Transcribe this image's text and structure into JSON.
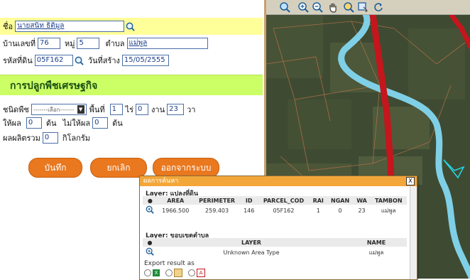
{
  "form": {
    "name_label": "ชื่อ",
    "name_value": "นายสนิท ธิติมูล",
    "house_label": "บ้านเลขที่",
    "house_value": "76",
    "moo_label": "หมู่",
    "moo_value": "5",
    "tambon_label": "ตำบล",
    "tambon_value": "แม่พูล",
    "land_code_label": "รหัสที่ดิน",
    "land_code_value": "05F162",
    "created_label": "วันที่สร้าง",
    "created_value": "15/05/2555",
    "section_title": "การปลูกพืชเศรษฐกิจ",
    "plant_type_label": "ชนิดพืช",
    "plant_type_value": "-------เลือก-------",
    "area_label": "พื้นที่",
    "rai_value": "1",
    "rai_label": "ไร่",
    "ngan_value": "0",
    "ngan_label": "งาน",
    "wa_value": "23",
    "wa_label": "วา",
    "yield_label": "ให้ผล",
    "yield_value": "0",
    "tree_unit": "ต้น",
    "noyield_label": "ไม่ให้ผล",
    "noyield_value": "0",
    "tree_unit2": "ต้น",
    "total_label": "ผลผลิตรวม",
    "total_value": "0",
    "kg_label": "กิโลกรัม"
  },
  "buttons": {
    "save": "บันทึก",
    "cancel": "ยกเลิก",
    "logout": "ออกจากระบบ"
  },
  "result": {
    "title": "ผลการค้นหา",
    "close": "X",
    "layer1_title": "Layer: แปลงที่ดิน",
    "layer1_headers": [
      "●",
      "AREA",
      "PERIMETER",
      "ID",
      "PARCEL_COD",
      "RAI",
      "NGAN",
      "WA",
      "TAMBON"
    ],
    "layer1_row": [
      "1966.500",
      "259.403",
      "146",
      "05F162",
      "1",
      "0",
      "23",
      "แม่พูล"
    ],
    "layer2_title": "Layer: ขอบเขตตำบล",
    "layer2_headers": [
      "●",
      "LAYER",
      "NAME"
    ],
    "layer2_row": [
      "Unknown Area Type",
      "แม่พูล"
    ],
    "export_label": "Export result as"
  },
  "colors": {
    "accent_button": "#e9781f",
    "name_bar": "#ffff99",
    "section_bar": "#ccff66",
    "window_title": "#f3a73a"
  }
}
